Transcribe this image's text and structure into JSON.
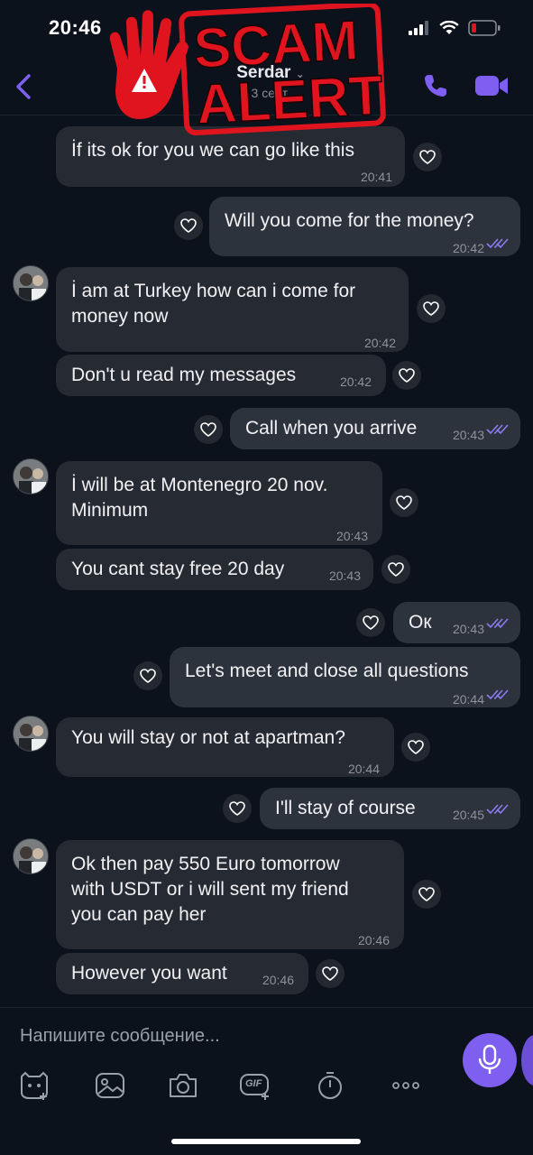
{
  "status_bar": {
    "time": "20:46"
  },
  "header": {
    "contact_name": "Serdar",
    "contact_status": "3 сент."
  },
  "overlay": {
    "line1": "SCAM",
    "line2": "ALERT"
  },
  "messages": [
    {
      "dir": "in",
      "text": "İf its ok for you we can go like this",
      "time": "20:41"
    },
    {
      "dir": "out",
      "text": "Will you come for the money?",
      "time": "20:42"
    },
    {
      "dir": "in",
      "text": "İ am at Turkey how can i come for\nmoney now",
      "time": "20:42"
    },
    {
      "dir": "in",
      "text": "Don't u read my messages",
      "time": "20:42"
    },
    {
      "dir": "out",
      "text": "Call when you arrive",
      "time": "20:43"
    },
    {
      "dir": "in",
      "text": "İ will be at Montenegro 20 nov.\nMinimum",
      "time": "20:43"
    },
    {
      "dir": "in",
      "text": "You cant stay free 20 day",
      "time": "20:43"
    },
    {
      "dir": "out",
      "text": "Ок",
      "time": "20:43"
    },
    {
      "dir": "out",
      "text": "Let's meet and close all questions",
      "time": "20:44"
    },
    {
      "dir": "in",
      "text": "You will stay or not at apartman?",
      "time": "20:44"
    },
    {
      "dir": "out",
      "text": "I'll stay of course",
      "time": "20:45"
    },
    {
      "dir": "in",
      "text": "Ok then pay 550 Euro tomorrow\nwith USDT or i will sent my friend\nyou can pay her",
      "time": "20:46"
    },
    {
      "dir": "in",
      "text": "However you want",
      "time": "20:46"
    }
  ],
  "composer": {
    "placeholder": "Напишите сообщение...",
    "gif_label": "GIF"
  },
  "colors": {
    "accent": "#7f5ff0",
    "alert_red": "#e0141e"
  }
}
